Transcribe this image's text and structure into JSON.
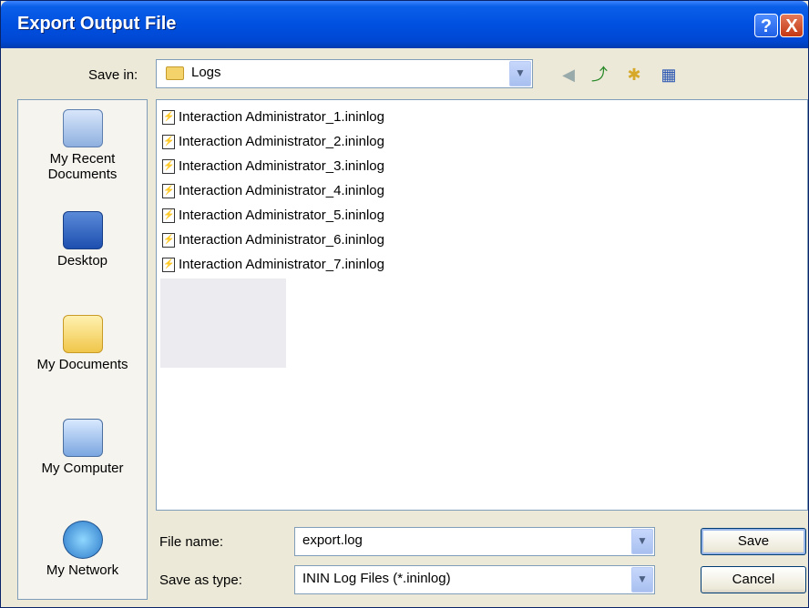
{
  "window": {
    "title": "Export Output File",
    "help_glyph": "?",
    "close_glyph": "X"
  },
  "toolbar": {
    "save_in_label": "Save in:",
    "save_in_value": "Logs",
    "icons": [
      "back-icon",
      "up-folder-icon",
      "new-folder-icon",
      "view-menu-icon"
    ]
  },
  "places": [
    {
      "label": "My Recent Documents",
      "icon": "recent-documents-icon"
    },
    {
      "label": "Desktop",
      "icon": "desktop-icon"
    },
    {
      "label": "My Documents",
      "icon": "my-documents-icon"
    },
    {
      "label": "My Computer",
      "icon": "my-computer-icon"
    },
    {
      "label": "My Network",
      "icon": "my-network-icon"
    }
  ],
  "files": [
    "Interaction Administrator_1.ininlog",
    "Interaction Administrator_2.ininlog",
    "Interaction Administrator_3.ininlog",
    "Interaction Administrator_4.ininlog",
    "Interaction Administrator_5.ininlog",
    "Interaction Administrator_6.ininlog",
    "Interaction Administrator_7.ininlog"
  ],
  "form": {
    "file_name_label": "File name:",
    "file_name_value": "export.log",
    "save_type_label": "Save as type:",
    "save_type_value": "ININ Log Files (*.ininlog)"
  },
  "buttons": {
    "save": "Save",
    "cancel": "Cancel"
  },
  "colors": {
    "titlebar": "#0050e0",
    "dialog_bg": "#ece9d8",
    "border": "#7f9db9"
  }
}
